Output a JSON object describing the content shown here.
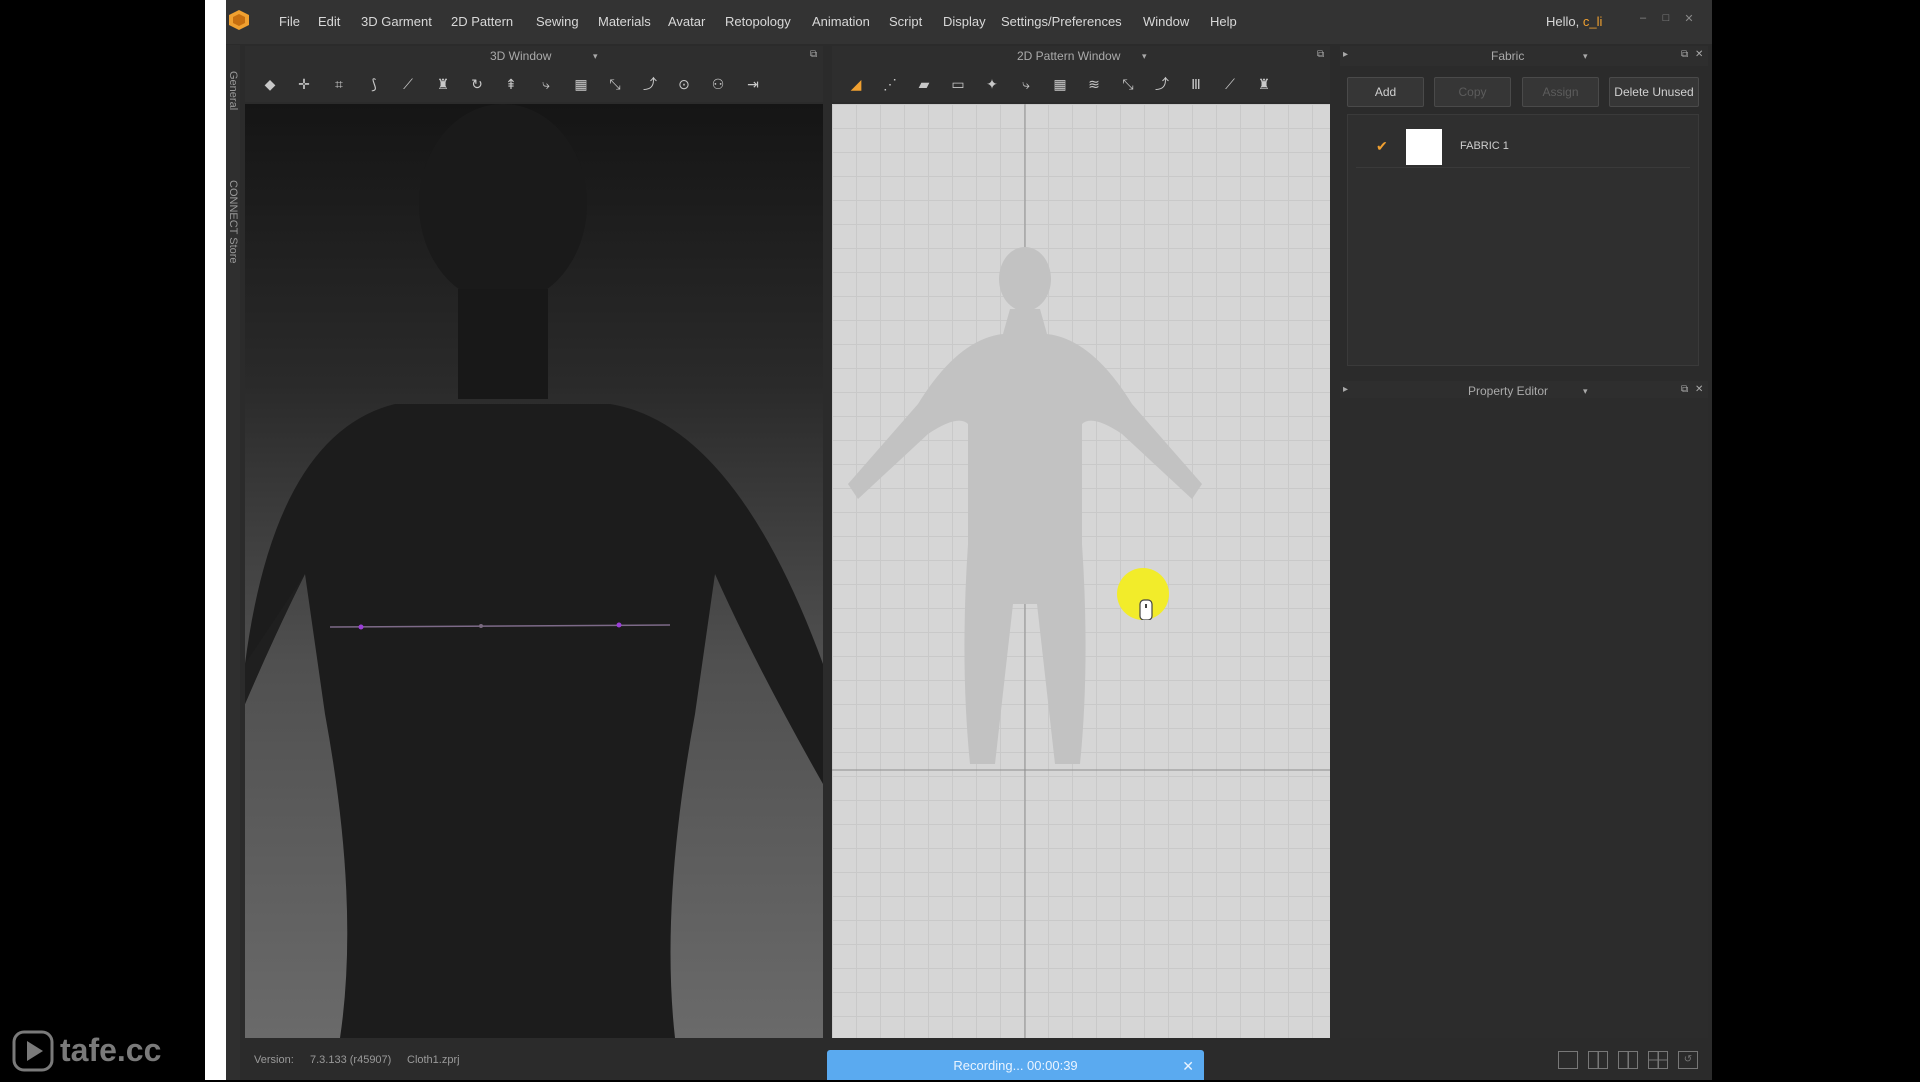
{
  "menu": [
    "File",
    "Edit",
    "3D Garment",
    "2D Pattern",
    "Sewing",
    "Materials",
    "Avatar",
    "Retopology",
    "Animation",
    "Script",
    "Display",
    "Settings/Preferences",
    "Window",
    "Help"
  ],
  "greeting": {
    "prefix": "Hello,",
    "user": "c_li"
  },
  "side_tabs": {
    "general": "General",
    "connect": "CONNECT Store"
  },
  "windows": {
    "w3d": "3D Window",
    "w2d": "2D Pattern Window",
    "fabric": "Fabric",
    "property": "Property Editor"
  },
  "fabric_buttons": {
    "add": "Add",
    "copy": "Copy",
    "assign": "Assign",
    "delete_unused": "Delete Unused"
  },
  "fabric_items": [
    {
      "name": "FABRIC 1",
      "checked": true,
      "swatch_color": "#ffffff"
    }
  ],
  "status": {
    "version_label": "Version:",
    "version": "7.3.133 (r45907)",
    "file": "Cloth1.zprj"
  },
  "recording": {
    "label": "Recording... 00:00:39"
  },
  "watermark": "tafe.cc",
  "colors": {
    "accent": "#f0a030",
    "recording_bar": "#5aaaf0",
    "cursor_highlight": "#f2ec2a",
    "measure_line": "#9b3fd8"
  }
}
